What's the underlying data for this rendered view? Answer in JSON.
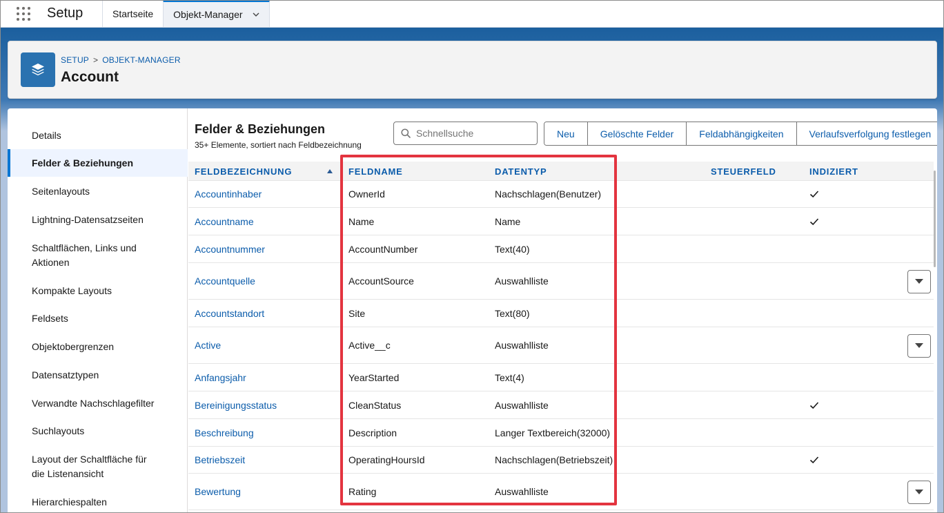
{
  "app": {
    "name": "Setup"
  },
  "tabs": [
    {
      "label": "Startseite"
    },
    {
      "label": "Objekt-Manager"
    }
  ],
  "header": {
    "breadcrumb": [
      "SETUP",
      "OBJEKT-MANAGER"
    ],
    "breadcrumb_sep": ">",
    "title": "Account"
  },
  "sidebar": {
    "items": [
      {
        "label": "Details"
      },
      {
        "label": "Felder & Beziehungen"
      },
      {
        "label": "Seitenlayouts"
      },
      {
        "label": "Lightning-Datensatzseiten"
      },
      {
        "label": "Schaltflächen, Links und Aktionen"
      },
      {
        "label": "Kompakte Layouts"
      },
      {
        "label": "Feldsets"
      },
      {
        "label": "Objektobergrenzen"
      },
      {
        "label": "Datensatztypen"
      },
      {
        "label": "Verwandte Nachschlagefilter"
      },
      {
        "label": "Suchlayouts"
      },
      {
        "label": "Layout der Schaltfläche für die Listenansicht"
      },
      {
        "label": "Hierarchiespalten"
      }
    ],
    "active_index": 1
  },
  "list": {
    "title": "Felder & Beziehungen",
    "subtitle": "35+ Elemente, sortiert nach Feldbezeichnung",
    "search_placeholder": "Schnellsuche",
    "buttons": [
      "Neu",
      "Gelöschte Felder",
      "Feldabhängigkeiten",
      "Verlaufsverfolgung festlegen"
    ]
  },
  "table": {
    "columns": [
      "FELDBEZEICHNUNG",
      "FELDNAME",
      "DATENTYP",
      "STEUERFELD",
      "INDIZIERT"
    ],
    "sort_column": "FELDBEZEICHNUNG",
    "sort_direction": "ascending",
    "rows": [
      {
        "label": "Accountinhaber",
        "name": "OwnerId",
        "type": "Nachschlagen(Benutzer)",
        "control": "",
        "indexed": true,
        "menu": false
      },
      {
        "label": "Accountname",
        "name": "Name",
        "type": "Name",
        "control": "",
        "indexed": true,
        "menu": false
      },
      {
        "label": "Accountnummer",
        "name": "AccountNumber",
        "type": "Text(40)",
        "control": "",
        "indexed": false,
        "menu": false
      },
      {
        "label": "Accountquelle",
        "name": "AccountSource",
        "type": "Auswahlliste",
        "control": "",
        "indexed": false,
        "menu": true
      },
      {
        "label": "Accountstandort",
        "name": "Site",
        "type": "Text(80)",
        "control": "",
        "indexed": false,
        "menu": false
      },
      {
        "label": "Active",
        "name": "Active__c",
        "type": "Auswahlliste",
        "control": "",
        "indexed": false,
        "menu": true
      },
      {
        "label": "Anfangsjahr",
        "name": "YearStarted",
        "type": "Text(4)",
        "control": "",
        "indexed": false,
        "menu": false
      },
      {
        "label": "Bereinigungsstatus",
        "name": "CleanStatus",
        "type": "Auswahlliste",
        "control": "",
        "indexed": true,
        "menu": false
      },
      {
        "label": "Beschreibung",
        "name": "Description",
        "type": "Langer Textbereich(32000)",
        "control": "",
        "indexed": false,
        "menu": false
      },
      {
        "label": "Betriebszeit",
        "name": "OperatingHoursId",
        "type": "Nachschlagen(Betriebszeit)",
        "control": "",
        "indexed": true,
        "menu": false
      },
      {
        "label": "Bewertung",
        "name": "Rating",
        "type": "Auswahlliste",
        "control": "",
        "indexed": false,
        "menu": true
      }
    ]
  },
  "icons": {
    "app_launcher": "app-launcher-icon",
    "object": "layers-icon",
    "search": "search-icon",
    "sort": "sort-ascending-icon",
    "check": "checkmark-icon",
    "dropdown": "chevron-down-icon"
  },
  "colors": {
    "link": "#0b5cab",
    "brand": "#0176d3",
    "highlight": "#e3343f",
    "object_icon": "#2a72b0"
  }
}
